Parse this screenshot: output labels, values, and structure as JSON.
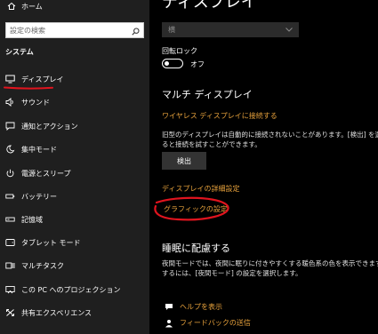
{
  "sidebar": {
    "home_label": "ホーム",
    "search_placeholder": "設定の検索",
    "section_title": "システム",
    "items": [
      {
        "label": "ディスプレイ",
        "icon": "monitor-icon"
      },
      {
        "label": "サウンド",
        "icon": "speaker-icon"
      },
      {
        "label": "通知とアクション",
        "icon": "notification-icon"
      },
      {
        "label": "集中モード",
        "icon": "moon-icon"
      },
      {
        "label": "電源とスリープ",
        "icon": "power-icon"
      },
      {
        "label": "バッテリー",
        "icon": "battery-icon"
      },
      {
        "label": "記憶域",
        "icon": "storage-icon"
      },
      {
        "label": "タブレット モード",
        "icon": "tablet-icon"
      },
      {
        "label": "マルチタスク",
        "icon": "multitask-icon"
      },
      {
        "label": "この PC へのプロジェクション",
        "icon": "projection-icon"
      },
      {
        "label": "共有エクスペリエンス",
        "icon": "shared-experience-icon"
      }
    ]
  },
  "main": {
    "title": "ディスプレイ",
    "orientation_value": "横",
    "rotation_lock_label": "回転ロック",
    "rotation_lock_state": "オフ",
    "multi_display_heading": "マルチ ディスプレイ",
    "wireless_link": "ワイヤレス ディスプレイに接続する",
    "detect_desc_line1": "旧型のディスプレイは自動的に接続されないことがあります。[検出] を選択す",
    "detect_desc_line2": "ると接続を試すことができます。",
    "detect_button": "検出",
    "advanced_link": "ディスプレイの詳細設定",
    "graphics_link": "グラフィックの設定",
    "sleep_heading": "睡眠に配慮する",
    "sleep_desc_line1": "夜間モードでは、夜間に眠りに付きやすくする暖色系の色を表示できます。",
    "sleep_desc_line2": "するには、[夜間モード] の設定を選択します。",
    "help_link": "ヘルプを表示",
    "feedback_link": "フィードバックの送信"
  },
  "colors": {
    "accent": "#e8a23c",
    "annotation": "#e0141e",
    "sidebar_bg": "#1f1f1f",
    "main_bg": "#000000"
  }
}
